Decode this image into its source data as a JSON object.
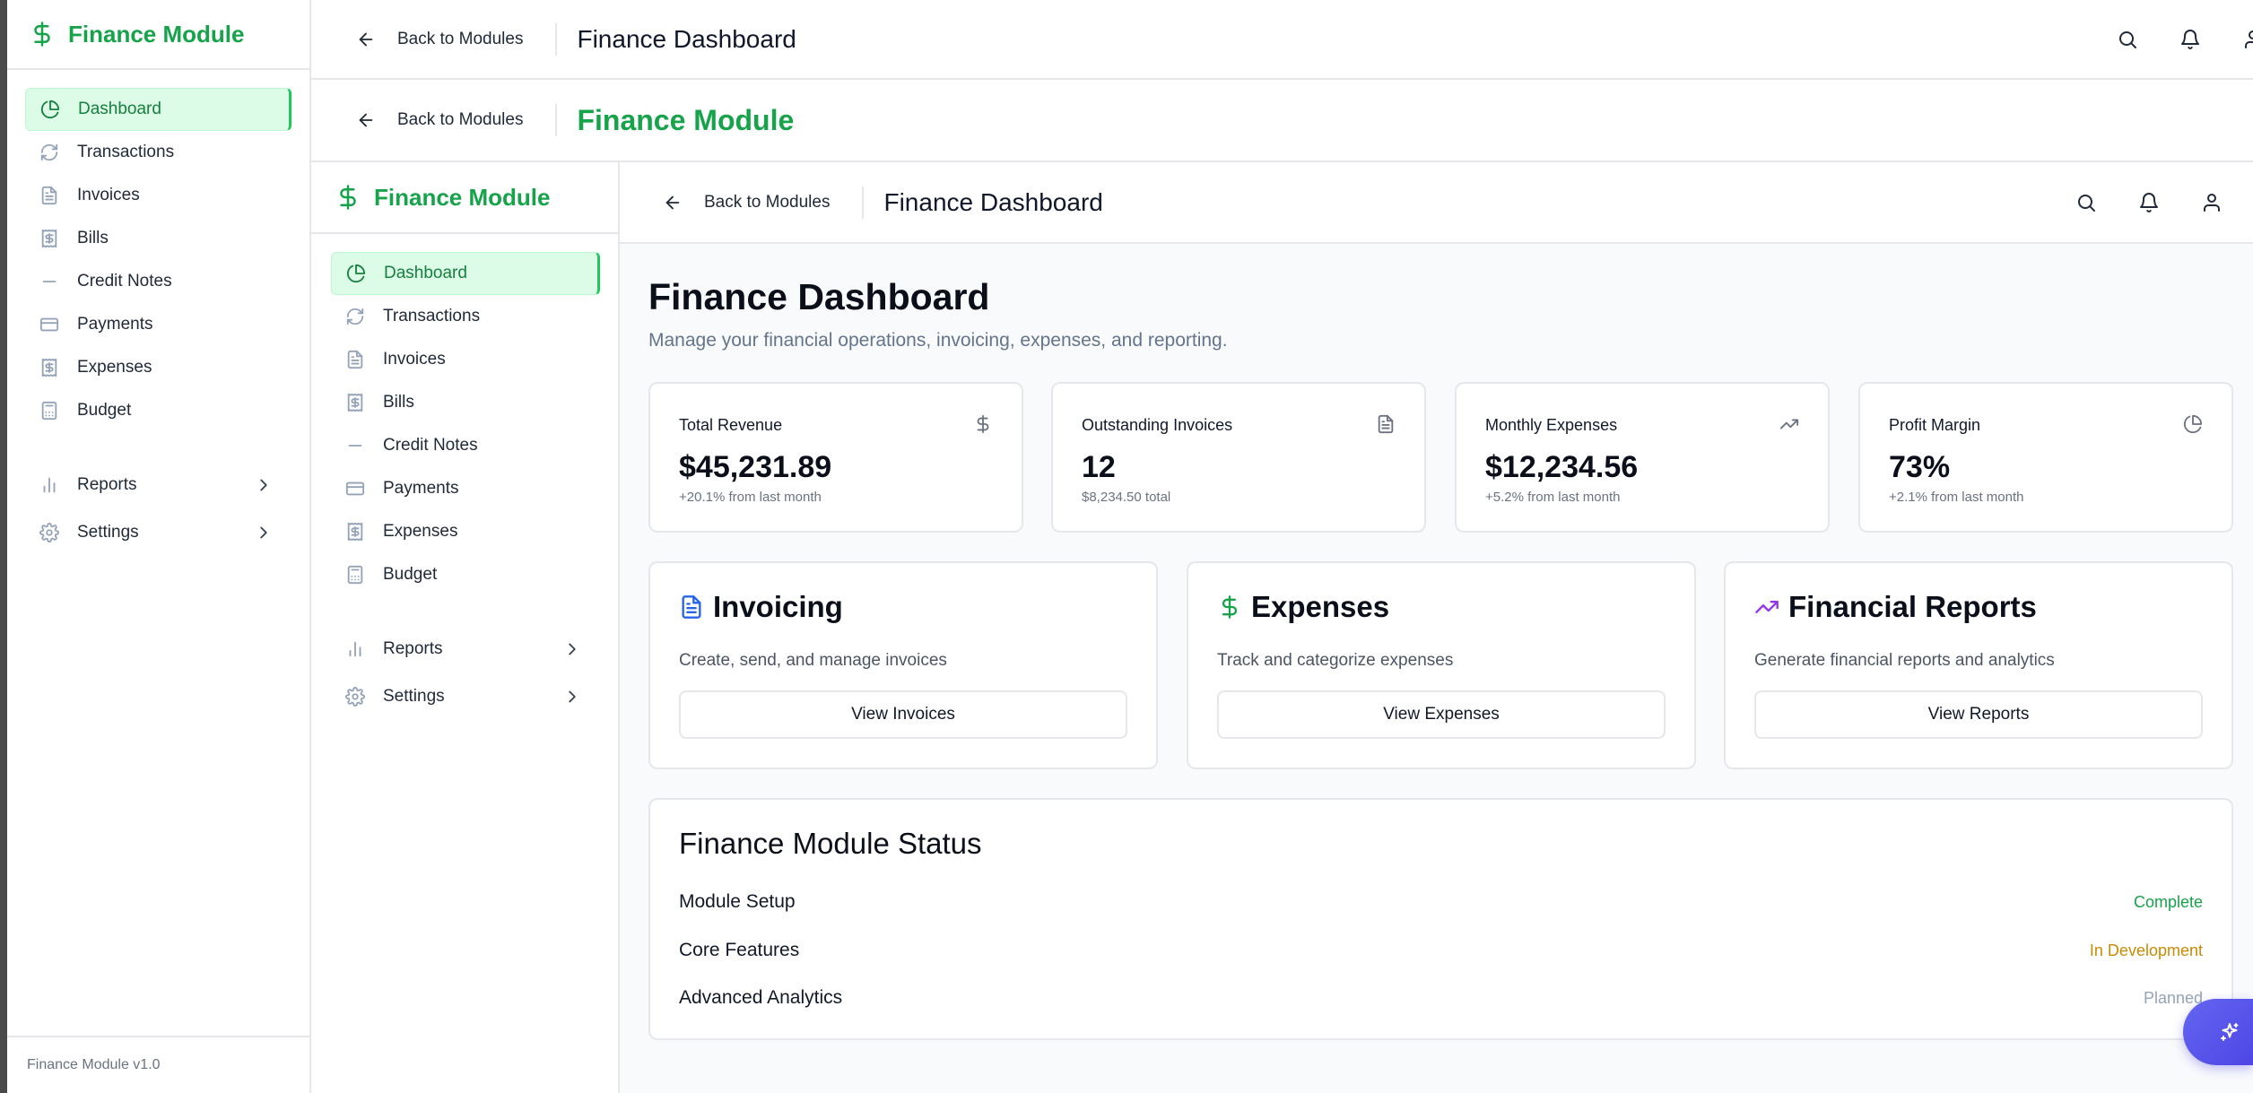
{
  "app": {
    "brand": "Finance Module",
    "version": "Finance Module v1.0"
  },
  "sidebar": {
    "items": [
      {
        "label": "Dashboard",
        "icon": "pie-chart-icon",
        "active": true
      },
      {
        "label": "Transactions",
        "icon": "refresh-icon"
      },
      {
        "label": "Invoices",
        "icon": "file-text-icon"
      },
      {
        "label": "Bills",
        "icon": "receipt-icon"
      },
      {
        "label": "Credit Notes",
        "icon": "minus-icon"
      },
      {
        "label": "Payments",
        "icon": "credit-card-icon"
      },
      {
        "label": "Expenses",
        "icon": "receipt-icon"
      },
      {
        "label": "Budget",
        "icon": "calculator-icon"
      }
    ],
    "groups": [
      {
        "label": "Reports",
        "icon": "bar-chart-icon"
      },
      {
        "label": "Settings",
        "icon": "gear-icon"
      }
    ]
  },
  "topbar": {
    "back_label": "Back to Modules",
    "title_dashboard": "Finance Dashboard",
    "title_module": "Finance Module"
  },
  "page": {
    "title": "Finance Dashboard",
    "subtitle": "Manage your financial operations, invoicing, expenses, and reporting."
  },
  "stats": [
    {
      "label": "Total Revenue",
      "value": "$45,231.89",
      "note": "+20.1% from last month",
      "icon": "dollar-icon"
    },
    {
      "label": "Outstanding Invoices",
      "value": "12",
      "note": "$8,234.50 total",
      "icon": "file-text-icon"
    },
    {
      "label": "Monthly Expenses",
      "value": "$12,234.56",
      "note": "+5.2% from last month",
      "icon": "trending-up-icon"
    },
    {
      "label": "Profit Margin",
      "value": "73%",
      "note": "+2.1% from last month",
      "icon": "pie-chart-icon"
    }
  ],
  "features": [
    {
      "title": "Invoicing",
      "desc": "Create, send, and manage invoices",
      "button": "View Invoices",
      "icon": "file-text-icon",
      "color": "#2563eb"
    },
    {
      "title": "Expenses",
      "desc": "Track and categorize expenses",
      "button": "View Expenses",
      "icon": "dollar-icon",
      "color": "#16a34a"
    },
    {
      "title": "Financial Reports",
      "desc": "Generate financial reports and analytics",
      "button": "View Reports",
      "icon": "trending-up-icon",
      "color": "#9333ea"
    }
  ],
  "status": {
    "title": "Finance Module Status",
    "rows": [
      {
        "label": "Module Setup",
        "value": "Complete",
        "color": "#16a34a"
      },
      {
        "label": "Core Features",
        "value": "In Development",
        "color": "#ca8a04"
      },
      {
        "label": "Advanced Analytics",
        "value": "Planned",
        "color": "#94a3b8"
      }
    ]
  },
  "colors": {
    "accent": "#16a34a",
    "active_bg": "#dcfce7"
  }
}
